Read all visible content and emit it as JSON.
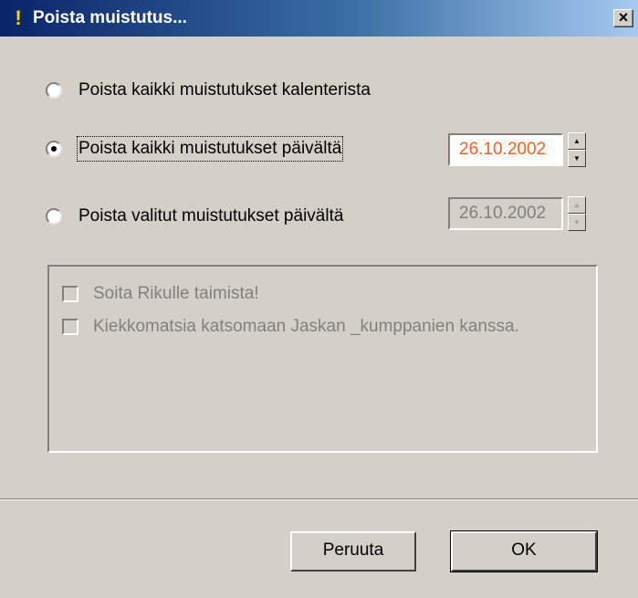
{
  "window": {
    "title": "Poista muistutus...",
    "close_glyph": "×"
  },
  "options": [
    {
      "label": "Poista kaikki muistutukset kalenterista",
      "checked": false
    },
    {
      "label": "Poista kaikki muistutukset päivältä",
      "checked": true
    },
    {
      "label": "Poista valitut muistutukset päivältä",
      "checked": false
    }
  ],
  "date_fields": {
    "active": {
      "value": "26.10.2002",
      "color": "#ff5a1e"
    },
    "disabled": {
      "value": "26.10.2002"
    }
  },
  "reminders": [
    {
      "label": "Soita Rikulle taimista!",
      "checked": false,
      "enabled": false
    },
    {
      "label": "Kiekkomatsia katsomaan Jaskan _kumppanien kanssa.",
      "checked": false,
      "enabled": false
    }
  ],
  "buttons": {
    "cancel": "Peruuta",
    "ok": "OK"
  },
  "icons": {
    "title_icon": "exclamation-icon",
    "close_icon": "close-icon"
  }
}
